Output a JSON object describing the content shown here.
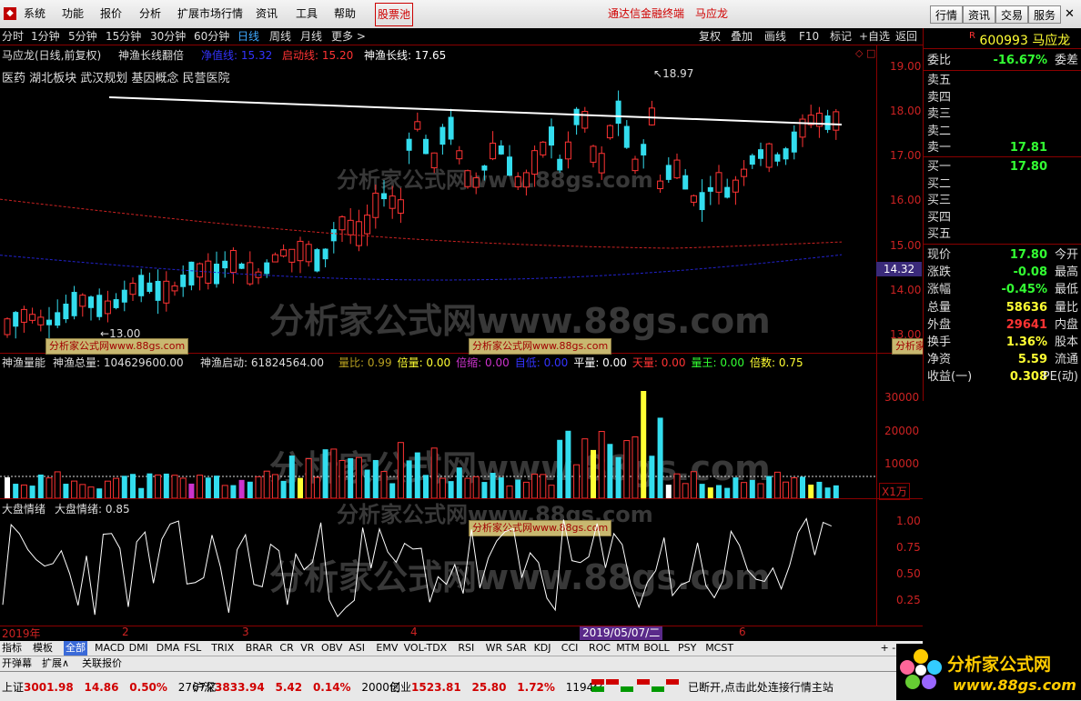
{
  "menu": {
    "items": [
      "系统",
      "功能",
      "报价",
      "分析",
      "扩展市场行情",
      "资讯",
      "工具",
      "帮助"
    ],
    "stock_pool": "股票池",
    "broker": "通达信金融终端",
    "stock_name": "马应龙",
    "right_buttons": [
      "行情",
      "资讯",
      "交易",
      "服务"
    ]
  },
  "periods": {
    "items": [
      "分时",
      "1分钟",
      "5分钟",
      "15分钟",
      "30分钟",
      "60分钟",
      "日线",
      "周线",
      "月线",
      "更多 >"
    ],
    "active": "日线",
    "right": [
      "复权",
      "叠加",
      "画线",
      "F10",
      "标记",
      "+自选",
      "返回"
    ]
  },
  "main_chart": {
    "title": "马应龙(日线,前复权)",
    "indicator_name": "神渔长线翻倍",
    "line1_label": "净值线:",
    "line1_value": "15.32",
    "line2_label": "启动线:",
    "line2_value": "15.20",
    "line3_label": "神渔长线:",
    "line3_value": "17.65",
    "concepts": "医药   湖北板块 武汉规划 基因概念 民营医院",
    "high_label": "18.97",
    "low_label": "13.00",
    "price_tag": "14.32",
    "y_ticks": [
      "19.00",
      "18.00",
      "17.00",
      "16.00",
      "15.00",
      "14.00",
      "13.00"
    ],
    "colors": {
      "up": "#ff3333",
      "down": "#33ddee",
      "long_line": "#ffffff",
      "red_line": "#cc2222",
      "blue_line": "#2222cc"
    }
  },
  "volume_chart": {
    "title": "神渔量能",
    "total_label": "神渔总量:",
    "total_value": "104629600.00",
    "start_label": "神渔启动:",
    "start_value": "61824564.00",
    "items": [
      {
        "label": "量比:",
        "value": "0.99",
        "color": "#b8a020"
      },
      {
        "label": "倍量:",
        "value": "0.00",
        "color": "#ffff33"
      },
      {
        "label": "倍缩:",
        "value": "0.00",
        "color": "#cc33cc"
      },
      {
        "label": "自低:",
        "value": "0.00",
        "color": "#3333ff"
      },
      {
        "label": "平量:",
        "value": "0.00",
        "color": "#ffffff"
      },
      {
        "label": "天量:",
        "value": "0.00",
        "color": "#ff3333"
      },
      {
        "label": "量王:",
        "value": "0.00",
        "color": "#33ff33"
      },
      {
        "label": "倍数:",
        "value": "0.75",
        "color": "#ffff33"
      }
    ],
    "y_ticks": [
      "30000",
      "20000",
      "10000"
    ],
    "unit": "X1万"
  },
  "mood_chart": {
    "title": "大盘情绪",
    "label": "大盘情绪:",
    "value": "0.85",
    "y_ticks": [
      "1.00",
      "0.75",
      "0.50",
      "0.25"
    ]
  },
  "x_axis": {
    "year": "2019年",
    "months": [
      "2",
      "3",
      "4",
      "6"
    ],
    "cursor_date": "2019/05/07/二"
  },
  "quote_panel": {
    "code": "600993",
    "name": "马应龙",
    "weibi_label": "委比",
    "weibi_value": "-16.67%",
    "weicha_label": "委差",
    "sells": [
      {
        "label": "卖五",
        "price": ""
      },
      {
        "label": "卖四",
        "price": ""
      },
      {
        "label": "卖三",
        "price": ""
      },
      {
        "label": "卖二",
        "price": ""
      },
      {
        "label": "卖一",
        "price": "17.81"
      }
    ],
    "buys": [
      {
        "label": "买一",
        "price": "17.80"
      },
      {
        "label": "买二",
        "price": ""
      },
      {
        "label": "买三",
        "price": ""
      },
      {
        "label": "买四",
        "price": ""
      },
      {
        "label": "买五",
        "price": ""
      }
    ],
    "stats": [
      {
        "left": "现价",
        "value": "17.80",
        "color": "#33ff33",
        "right": "今开"
      },
      {
        "left": "涨跌",
        "value": "-0.08",
        "color": "#33ff33",
        "right": "最高"
      },
      {
        "left": "涨幅",
        "value": "-0.45%",
        "color": "#33ff33",
        "right": "最低"
      },
      {
        "left": "总量",
        "value": "58636",
        "color": "#ffff33",
        "right": "量比"
      },
      {
        "left": "外盘",
        "value": "29641",
        "color": "#ff3333",
        "right": "内盘"
      },
      {
        "left": "换手",
        "value": "1.36%",
        "color": "#ffff33",
        "right": "股本"
      },
      {
        "left": "净资",
        "value": "5.59",
        "color": "#ffff33",
        "right": "流通"
      },
      {
        "left": "收益(一)",
        "value": "0.308",
        "color": "#ffff33",
        "right": "PE(动)"
      }
    ]
  },
  "indicator_tabs": [
    "指标",
    "模板",
    "全部",
    "MACD",
    "DMI",
    "DMA",
    "FSL",
    "TRIX",
    "BRAR",
    "CR",
    "VR",
    "OBV",
    "ASI",
    "EMV",
    "VOL-TDX",
    "RSI",
    "WR",
    "SAR",
    "KDJ",
    "CCI",
    "ROC",
    "MTM",
    "BOLL",
    "PSY",
    "MCST"
  ],
  "bottom_tabs": [
    "开弹幕",
    "扩展∧",
    "关联报价"
  ],
  "status": {
    "sh_label": "上证",
    "sh_value": "3001.98",
    "sh_change": "14.86",
    "sh_pct": "0.50%",
    "sh_amount": "2767亿",
    "sz_label": "沪深",
    "sz_value": "3833.94",
    "sz_change": "5.42",
    "sz_pct": "0.14%",
    "sz_amount": "2000亿",
    "cy_label": "创业",
    "cy_value": "1523.81",
    "cy_change": "25.80",
    "cy_pct": "1.72%",
    "cy_amount": "1194亿",
    "message": "已断开,点击此处连接行情主站",
    "logo_text": "分析家公式网",
    "logo_url": "www.88gs.com"
  },
  "watermarks": {
    "big": "分析家公式网www.88gs.com",
    "small": "分析家公式网www.88gs.com"
  }
}
